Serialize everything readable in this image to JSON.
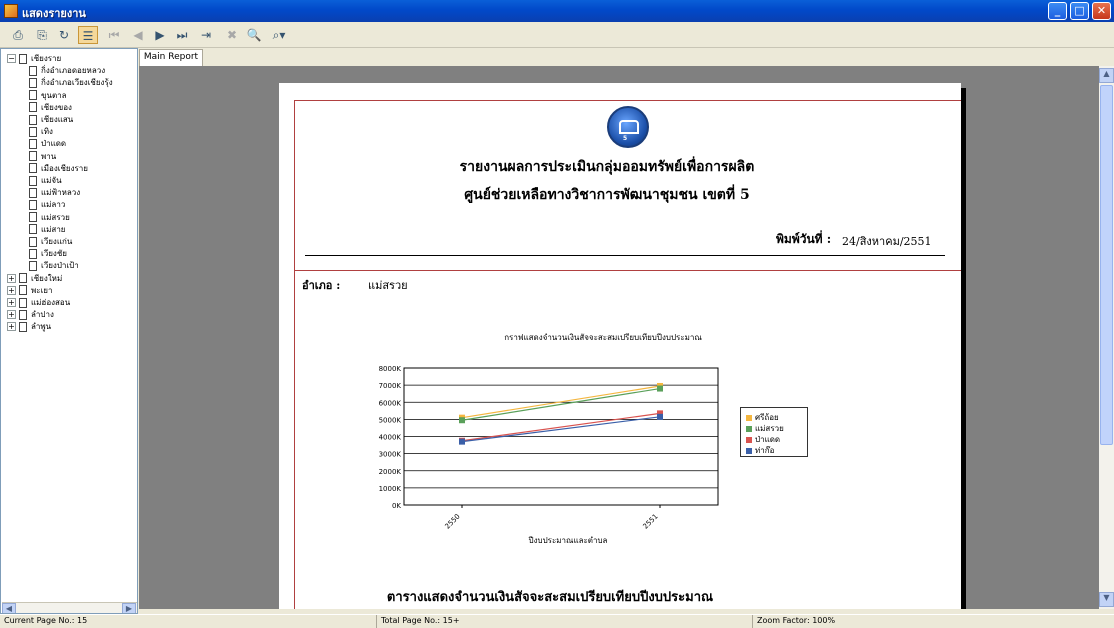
{
  "window": {
    "title": "แสดงรายงาน",
    "controls": {
      "minimize": "_",
      "maximize": "□",
      "close": "✕"
    }
  },
  "toolbar": {
    "icons": [
      {
        "name": "export-icon",
        "glyph": "⎙"
      },
      {
        "name": "print-icon",
        "glyph": "⎘"
      },
      {
        "name": "refresh-icon",
        "glyph": "↻"
      },
      {
        "name": "group-tree-icon",
        "glyph": "☰"
      },
      {
        "name": "first-page-icon",
        "glyph": "⏮"
      },
      {
        "name": "prev-page-icon",
        "glyph": "◀"
      },
      {
        "name": "next-page-icon",
        "glyph": "▶"
      },
      {
        "name": "last-page-icon",
        "glyph": "⏭"
      },
      {
        "name": "goto-page-icon",
        "glyph": "⇥"
      },
      {
        "name": "close-view-icon",
        "glyph": "✖"
      },
      {
        "name": "search-icon",
        "glyph": "🔍"
      },
      {
        "name": "zoom-icon",
        "glyph": "⌕▾"
      }
    ]
  },
  "tree": {
    "root": "เชียงราย",
    "children": [
      "กิ่งอำเภอดอยหลวง",
      "กิ่งอำเภอเวียงเชียงรุ้ง",
      "ขุนตาล",
      "เชียงของ",
      "เชียงแสน",
      "เทิง",
      "ป่าแดด",
      "พาน",
      "เมืองเชียงราย",
      "แม่จัน",
      "แม่ฟ้าหลวง",
      "แม่ลาว",
      "แม่สรวย",
      "แม่สาย",
      "เวียงแก่น",
      "เวียงชัย",
      "เวียงป่าเป้า"
    ],
    "other_roots": [
      "เชียงใหม่",
      "พะเยา",
      "แม่ฮ่องสอน",
      "ลำปาง",
      "ลำพูน"
    ]
  },
  "tabs": [
    "Main Report"
  ],
  "report": {
    "title1": "รายงานผลการประเมินกลุ่มออมทรัพย์เพื่อการผลิต",
    "title2": "ศูนย์ช่วยเหลือทางวิชาการพัฒนาชุมชน เขตที่ 5",
    "print_label": "พิมพ์วันที่ :",
    "print_date": "24/สิงหาคม/2551",
    "amphoe_label": "อำเภอ :",
    "amphoe_value": "แม่สรวย",
    "table_title": "ตารางแสดงจำนวนเงินสัจจะสะสมเปรียบเทียบปีงบประมาณ"
  },
  "chart_data": {
    "type": "line",
    "title": "กราฟแสดงจำนวนเงินสัจจะสะสมเปรียบเทียบปีงบประมาณ",
    "xlabel": "ปีงบประมาณและตำบล",
    "ylabel": "",
    "categories": [
      "2550",
      "2551"
    ],
    "ylim": [
      0,
      8000
    ],
    "yticks": [
      "0K",
      "1000K",
      "2000K",
      "3000K",
      "4000K",
      "5000K",
      "6000K",
      "7000K",
      "8000K"
    ],
    "series": [
      {
        "name": "ศรีถ้อย",
        "color": "#f4b63f",
        "values": [
          5100,
          6950
        ]
      },
      {
        "name": "แม่สรวย",
        "color": "#5aa05a",
        "values": [
          4950,
          6800
        ]
      },
      {
        "name": "ป่าแดด",
        "color": "#d9534f",
        "values": [
          3750,
          5350
        ]
      },
      {
        "name": "ท่าก๊อ",
        "color": "#3a5fa8",
        "values": [
          3700,
          5150
        ]
      }
    ],
    "legend": "right"
  },
  "status": {
    "current": "Current Page No.: 15",
    "total": "Total Page No.: 15+",
    "zoom": "Zoom Factor: 100%"
  }
}
